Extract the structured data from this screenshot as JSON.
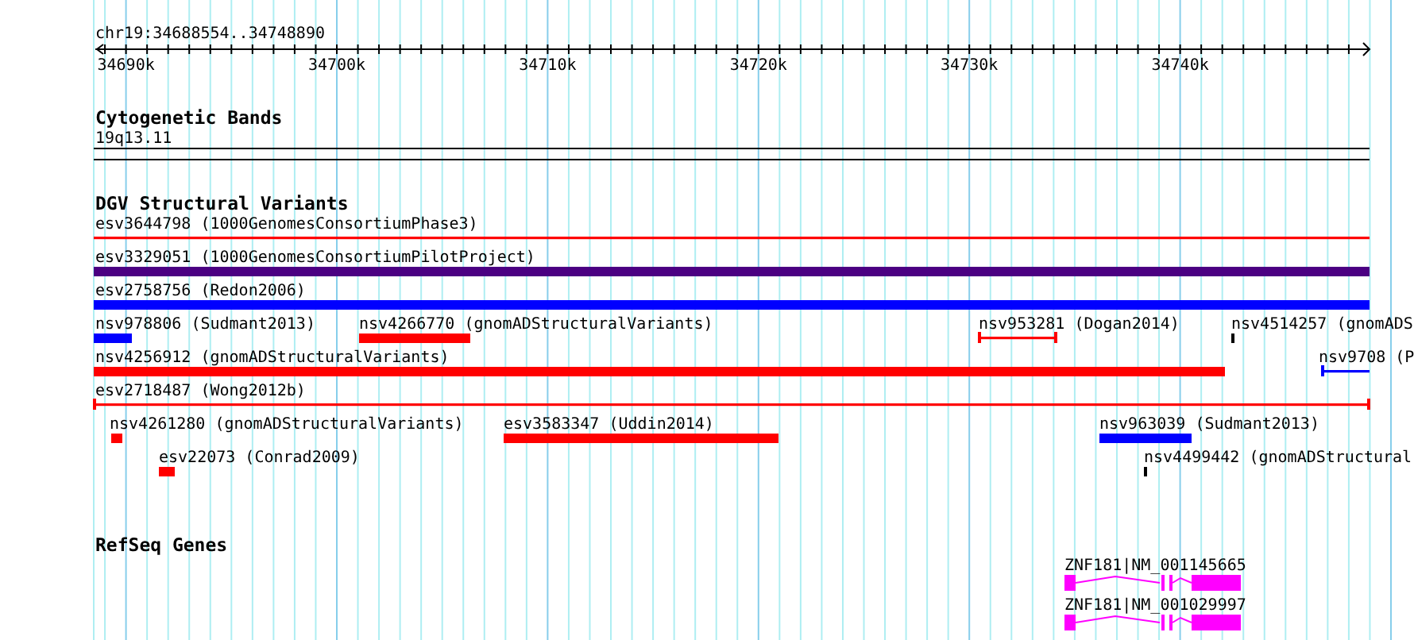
{
  "ruler": {
    "location": "chr19:34688554..34748890",
    "ticks": [
      "34690k",
      "34700k",
      "34710k",
      "34720k",
      "34730k",
      "34740k"
    ]
  },
  "cytoband_track": {
    "title": "Cytogenetic Bands",
    "band": "19q13.11"
  },
  "variant_track": {
    "title": "DGV Structural Variants",
    "features": [
      {
        "label": "esv3644798 (1000GenomesConsortiumPhase3)",
        "kind": "line",
        "color": "#ff0000"
      },
      {
        "label": "esv3329051 (1000GenomesConsortiumPilotProject)",
        "kind": "bar",
        "color": "#4b0082"
      },
      {
        "label": "esv2758756 (Redon2006)",
        "kind": "bar",
        "color": "#0000ff"
      },
      {
        "label": "nsv978806 (Sudmant2013)",
        "kind": "bar",
        "color": "#0000ff"
      },
      {
        "label": "nsv4266770 (gnomADStructuralVariants)",
        "kind": "bar",
        "color": "#ff0000"
      },
      {
        "label": "nsv953281 (Dogan2014)",
        "kind": "line",
        "color": "#ff0000"
      },
      {
        "label": "nsv4514257 (gnomADS",
        "kind": "tick",
        "color": "#000000"
      },
      {
        "label": "nsv4256912 (gnomADStructuralVariants)",
        "kind": "bar",
        "color": "#ff0000"
      },
      {
        "label": "nsv9708 (P",
        "kind": "line",
        "color": "#0000ff"
      },
      {
        "label": "esv2718487 (Wong2012b)",
        "kind": "line",
        "color": "#ff0000"
      },
      {
        "label": "nsv4261280 (gnomADStructuralVariants)",
        "kind": "bar",
        "color": "#ff0000"
      },
      {
        "label": "esv3583347 (Uddin2014)",
        "kind": "bar",
        "color": "#ff0000"
      },
      {
        "label": "nsv963039 (Sudmant2013)",
        "kind": "bar",
        "color": "#0000ff"
      },
      {
        "label": "esv22073 (Conrad2009)",
        "kind": "bar",
        "color": "#ff0000"
      },
      {
        "label": "nsv4499442 (gnomADStructural",
        "kind": "tick",
        "color": "#000000"
      }
    ]
  },
  "gene_track": {
    "title": "RefSeq Genes",
    "genes": [
      {
        "label": "ZNF181|NM_001145665",
        "color": "#ff00ff"
      },
      {
        "label": "ZNF181|NM_001029997",
        "color": "#ff00ff"
      }
    ]
  }
}
